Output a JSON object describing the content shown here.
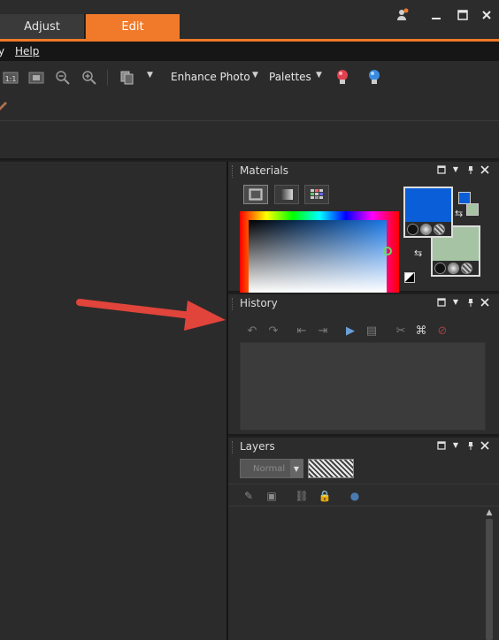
{
  "tabs": [
    {
      "label": "Adjust",
      "active": false
    },
    {
      "label": "Edit",
      "active": true
    }
  ],
  "window_controls": [
    "user-icon",
    "minimize-icon",
    "maximize-icon",
    "close-icon"
  ],
  "menu": {
    "items": [
      "y",
      "Help"
    ]
  },
  "toolbar": {
    "enhance_photo": "Enhance Photo",
    "palettes": "Palettes"
  },
  "materials": {
    "title": "Materials",
    "foreground_color": "#0a5fd8",
    "background_color": "#a6c4a4"
  },
  "history": {
    "title": "History"
  },
  "layers": {
    "title": "Layers",
    "blend_mode": "Normal"
  },
  "accent_color": "#f07a2a",
  "annotation_color": "#e0443a"
}
